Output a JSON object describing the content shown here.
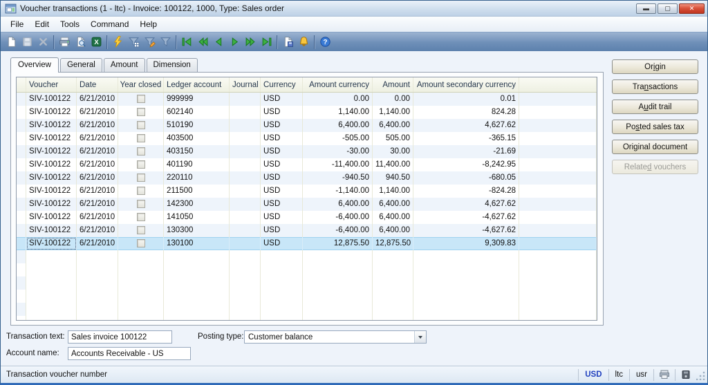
{
  "window": {
    "title": "Voucher transactions (1 - ltc) - Invoice: 100122, 1000, Type: Sales order"
  },
  "menu": {
    "items": [
      "File",
      "Edit",
      "Tools",
      "Command",
      "Help"
    ]
  },
  "toolbar": {
    "groups": [
      {
        "items": [
          {
            "name": "new-record",
            "enabled": true
          },
          {
            "name": "save-record",
            "enabled": false
          },
          {
            "name": "delete-record",
            "enabled": false
          }
        ]
      },
      {
        "items": [
          {
            "name": "print",
            "enabled": true
          },
          {
            "name": "print-preview",
            "enabled": true
          },
          {
            "name": "export-to-excel",
            "enabled": true
          }
        ]
      },
      {
        "items": [
          {
            "name": "filter-by-field",
            "enabled": true
          },
          {
            "name": "filter-by-grid",
            "enabled": true
          },
          {
            "name": "advanced-filter",
            "enabled": true
          },
          {
            "name": "remove-filter",
            "enabled": true
          }
        ]
      },
      {
        "items": [
          {
            "name": "first-record",
            "enabled": true
          },
          {
            "name": "previous-page",
            "enabled": true
          },
          {
            "name": "previous-record",
            "enabled": true
          },
          {
            "name": "next-record",
            "enabled": true
          },
          {
            "name": "next-page",
            "enabled": true
          },
          {
            "name": "last-record",
            "enabled": true
          }
        ]
      },
      {
        "items": [
          {
            "name": "document-handling",
            "enabled": true
          },
          {
            "name": "alerts",
            "enabled": true
          }
        ]
      },
      {
        "items": [
          {
            "name": "help",
            "enabled": true
          }
        ]
      }
    ]
  },
  "tabs": [
    {
      "label": "Overview",
      "active": true
    },
    {
      "label": "General",
      "active": false
    },
    {
      "label": "Amount",
      "active": false
    },
    {
      "label": "Dimension",
      "active": false
    }
  ],
  "grid": {
    "columns": [
      "Voucher",
      "Date",
      "Year closed",
      "Ledger account",
      "Journal",
      "Currency",
      "Amount currency",
      "Amount",
      "Amount secondary currency"
    ],
    "selected_row_index": 11,
    "rows": [
      {
        "voucher": "SIV-100122",
        "date": "6/21/2010",
        "year_closed": false,
        "ledger_account": "999999",
        "journal": "",
        "currency": "USD",
        "amount_currency": "0.00",
        "amount": "0.00",
        "amount_secondary_currency": "0.01"
      },
      {
        "voucher": "SIV-100122",
        "date": "6/21/2010",
        "year_closed": false,
        "ledger_account": "602140",
        "journal": "",
        "currency": "USD",
        "amount_currency": "1,140.00",
        "amount": "1,140.00",
        "amount_secondary_currency": "824.28"
      },
      {
        "voucher": "SIV-100122",
        "date": "6/21/2010",
        "year_closed": false,
        "ledger_account": "510190",
        "journal": "",
        "currency": "USD",
        "amount_currency": "6,400.00",
        "amount": "6,400.00",
        "amount_secondary_currency": "4,627.62"
      },
      {
        "voucher": "SIV-100122",
        "date": "6/21/2010",
        "year_closed": false,
        "ledger_account": "403500",
        "journal": "",
        "currency": "USD",
        "amount_currency": "-505.00",
        "amount": "505.00",
        "amount_secondary_currency": "-365.15"
      },
      {
        "voucher": "SIV-100122",
        "date": "6/21/2010",
        "year_closed": false,
        "ledger_account": "403150",
        "journal": "",
        "currency": "USD",
        "amount_currency": "-30.00",
        "amount": "30.00",
        "amount_secondary_currency": "-21.69"
      },
      {
        "voucher": "SIV-100122",
        "date": "6/21/2010",
        "year_closed": false,
        "ledger_account": "401190",
        "journal": "",
        "currency": "USD",
        "amount_currency": "-11,400.00",
        "amount": "11,400.00",
        "amount_secondary_currency": "-8,242.95"
      },
      {
        "voucher": "SIV-100122",
        "date": "6/21/2010",
        "year_closed": false,
        "ledger_account": "220110",
        "journal": "",
        "currency": "USD",
        "amount_currency": "-940.50",
        "amount": "940.50",
        "amount_secondary_currency": "-680.05"
      },
      {
        "voucher": "SIV-100122",
        "date": "6/21/2010",
        "year_closed": false,
        "ledger_account": "211500",
        "journal": "",
        "currency": "USD",
        "amount_currency": "-1,140.00",
        "amount": "1,140.00",
        "amount_secondary_currency": "-824.28"
      },
      {
        "voucher": "SIV-100122",
        "date": "6/21/2010",
        "year_closed": false,
        "ledger_account": "142300",
        "journal": "",
        "currency": "USD",
        "amount_currency": "6,400.00",
        "amount": "6,400.00",
        "amount_secondary_currency": "4,627.62"
      },
      {
        "voucher": "SIV-100122",
        "date": "6/21/2010",
        "year_closed": false,
        "ledger_account": "141050",
        "journal": "",
        "currency": "USD",
        "amount_currency": "-6,400.00",
        "amount": "6,400.00",
        "amount_secondary_currency": "-4,627.62"
      },
      {
        "voucher": "SIV-100122",
        "date": "6/21/2010",
        "year_closed": false,
        "ledger_account": "130300",
        "journal": "",
        "currency": "USD",
        "amount_currency": "-6,400.00",
        "amount": "6,400.00",
        "amount_secondary_currency": "-4,627.62"
      },
      {
        "voucher": "SIV-100122",
        "date": "6/21/2010",
        "year_closed": false,
        "ledger_account": "130100",
        "journal": "",
        "currency": "USD",
        "amount_currency": "12,875.50",
        "amount": "12,875.50",
        "amount_secondary_currency": "9,309.83"
      }
    ]
  },
  "side_buttons": [
    {
      "pre": "Or",
      "key": "i",
      "post": "gin",
      "enabled": true
    },
    {
      "pre": "Tra",
      "key": "n",
      "post": "sactions",
      "enabled": true
    },
    {
      "pre": "A",
      "key": "u",
      "post": "dit trail",
      "enabled": true
    },
    {
      "pre": "Po",
      "key": "s",
      "post": "ted sales tax",
      "enabled": true
    },
    {
      "pre": "Ori",
      "key": "g",
      "post": "inal document",
      "enabled": true
    },
    {
      "pre": "Relate",
      "key": "d",
      "post": " vouchers",
      "enabled": false
    }
  ],
  "fields": {
    "transaction_text_label": "Transaction text:",
    "transaction_text_value": "Sales invoice 100122",
    "posting_type_label": "Posting type:",
    "posting_type_value": "Customer balance",
    "account_name_label": "Account name:",
    "account_name_value": "Accounts Receivable - US"
  },
  "statusbar": {
    "message": "Transaction voucher number",
    "currency": "USD",
    "company": "ltc",
    "user": "usr"
  },
  "colors": {
    "selected_row": "#c8e6f8",
    "toolbar_blue": "#6e8fb8",
    "status_currency_text": "#1f3fbe",
    "nav_arrow_green": "#3fb044"
  }
}
